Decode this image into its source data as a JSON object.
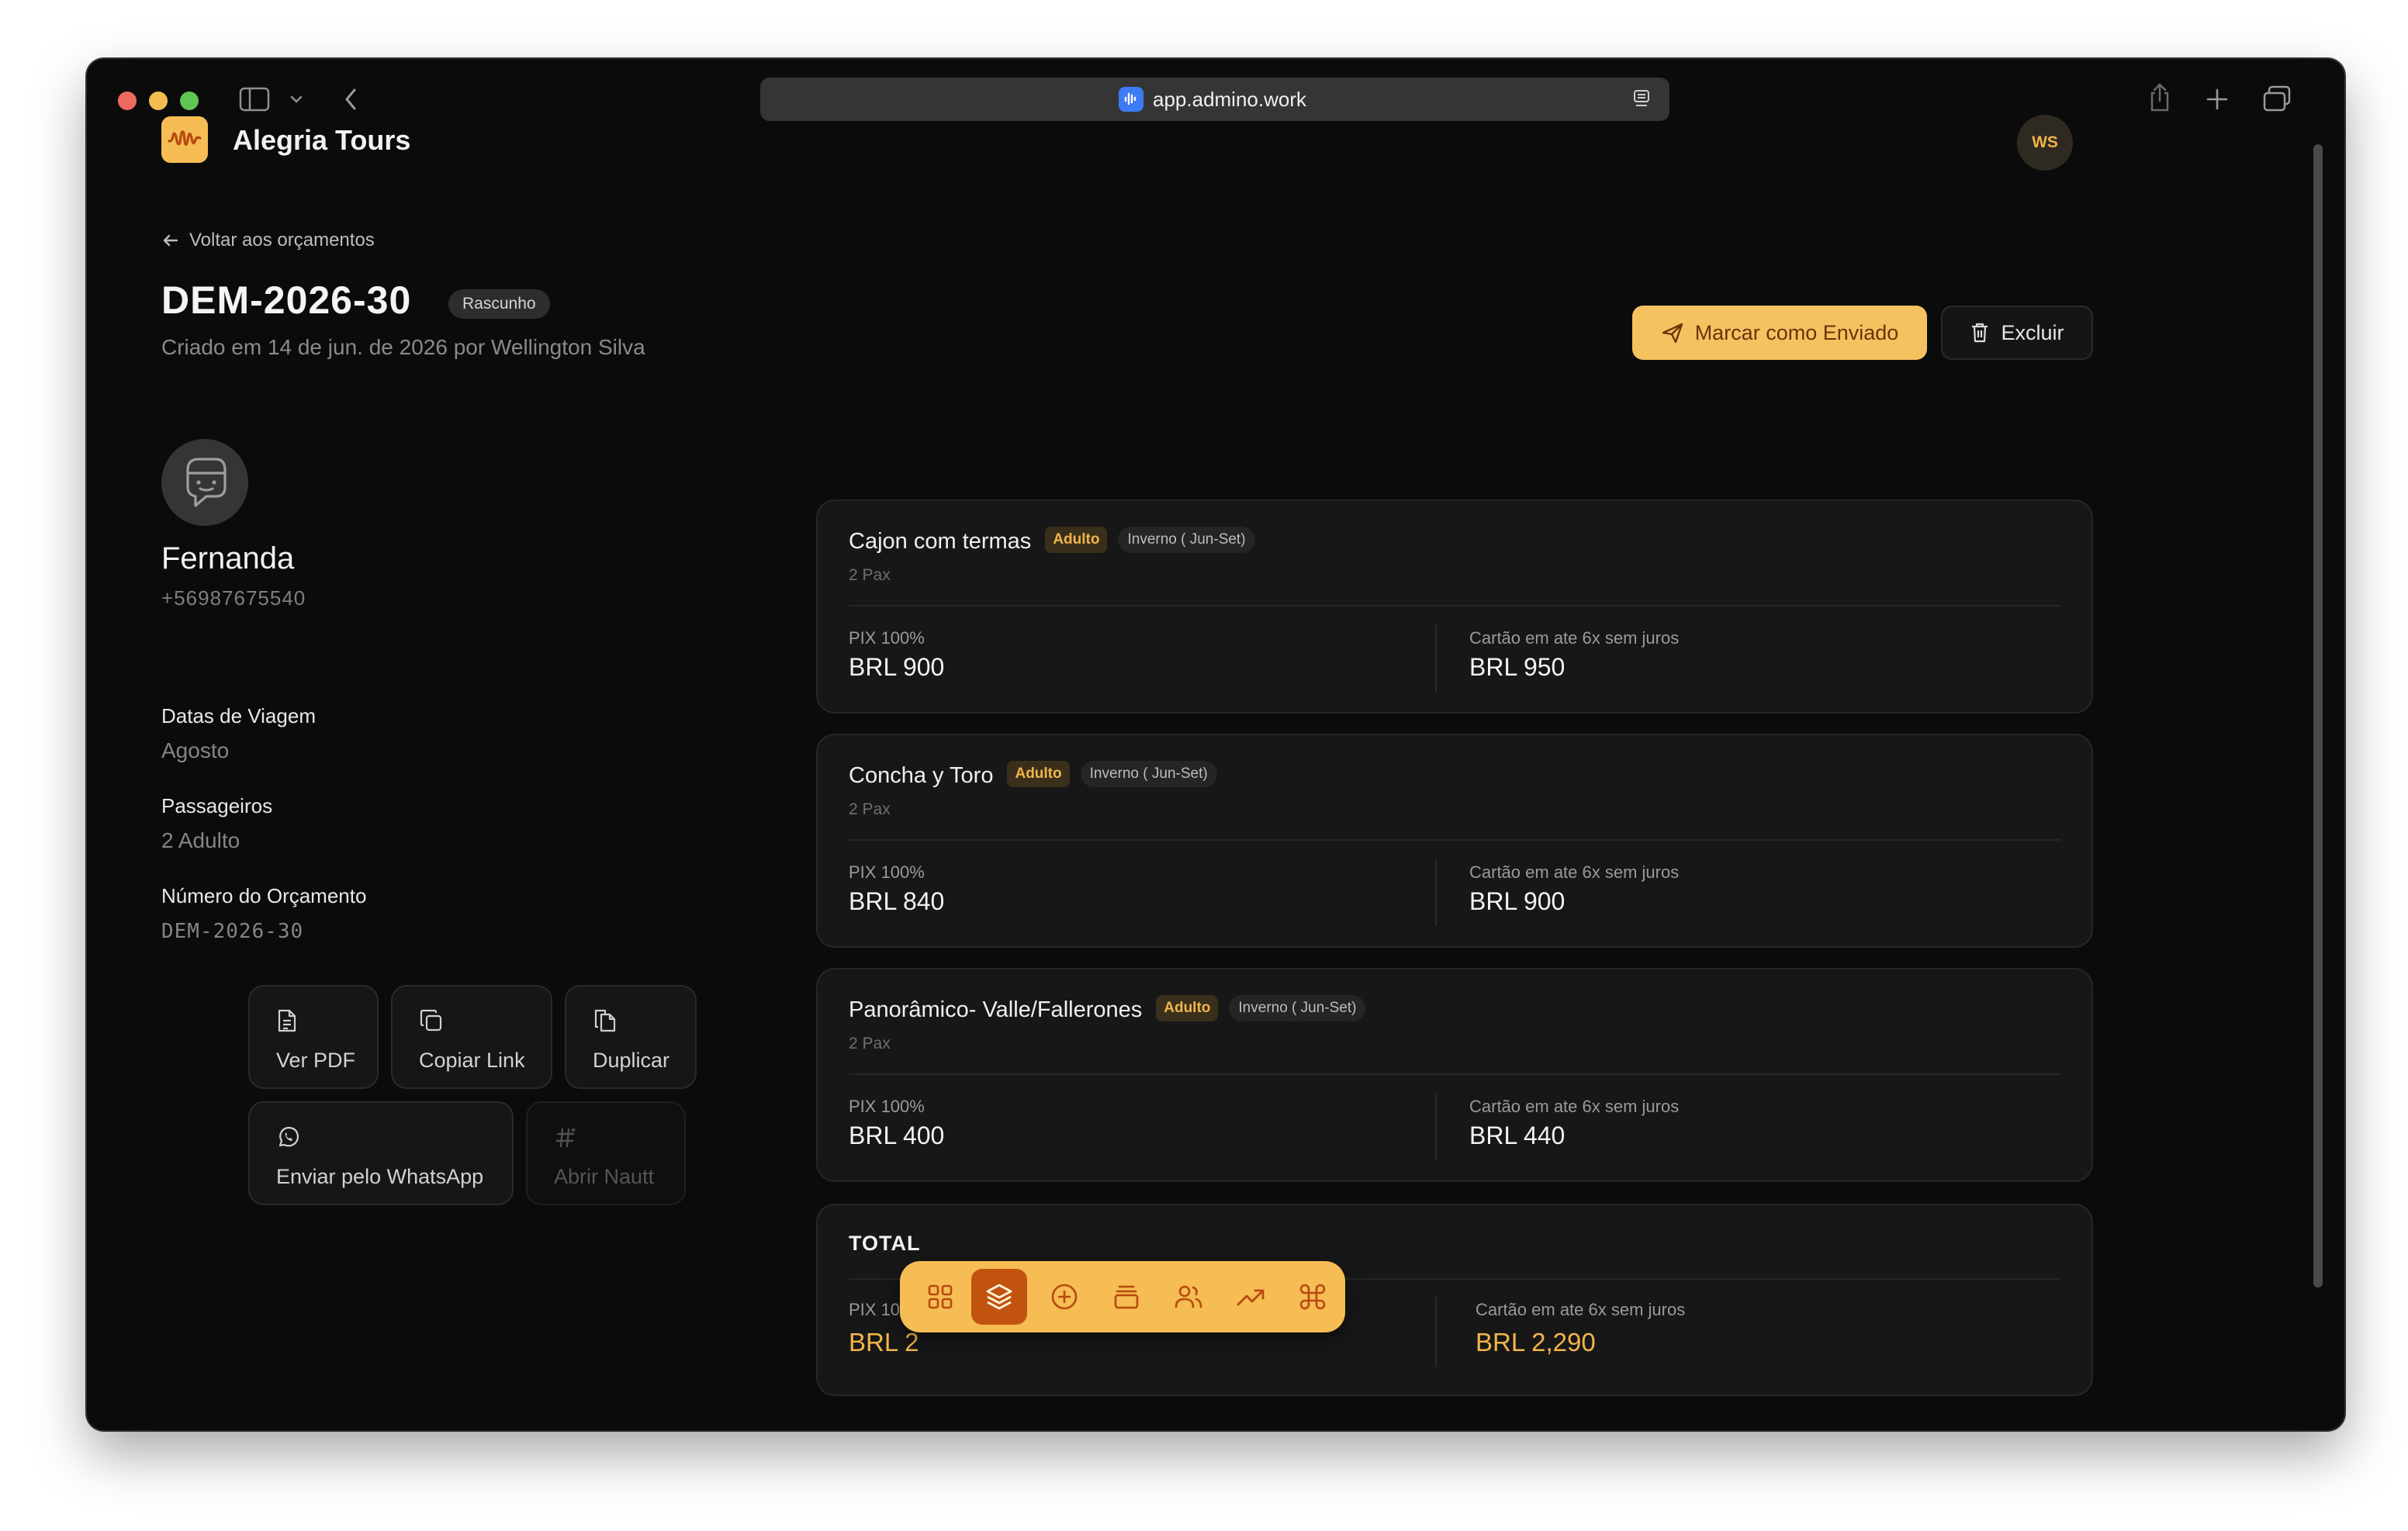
{
  "browser": {
    "url": "app.admino.work"
  },
  "app": {
    "brand": "Alegria Tours",
    "user_initials": "WS"
  },
  "page": {
    "back_label": "Voltar aos orçamentos",
    "quote_id": "DEM-2026-30",
    "status": "Rascunho",
    "created": "Criado em 14 de jun. de 2026 por Wellington Silva",
    "mark_sent_label": "Marcar como Enviado",
    "delete_label": "Excluir"
  },
  "client": {
    "name": "Fernanda",
    "phone": "+56987675540",
    "fields": [
      {
        "label": "Datas de Viagem",
        "value": "Agosto"
      },
      {
        "label": "Passageiros",
        "value": "2 Adulto"
      },
      {
        "label": "Número do Orçamento",
        "value": "DEM-2026-30"
      }
    ]
  },
  "actions": {
    "view_pdf": "Ver PDF",
    "copy_link": "Copiar Link",
    "duplicate": "Duplicar",
    "whatsapp": "Enviar pelo WhatsApp",
    "nautt": "Abrir Nautt"
  },
  "tours": [
    {
      "name": "Cajon com termas",
      "type": "Adulto",
      "season": "Inverno ( Jun-Set)",
      "pax": "2 Pax",
      "pix_label": "PIX 100%",
      "pix_value": "BRL 900",
      "card_label": "Cartão em ate 6x sem juros",
      "card_value": "BRL 950"
    },
    {
      "name": "Concha y Toro",
      "type": "Adulto",
      "season": "Inverno ( Jun-Set)",
      "pax": "2 Pax",
      "pix_label": "PIX 100%",
      "pix_value": "BRL 840",
      "card_label": "Cartão em ate 6x sem juros",
      "card_value": "BRL 900"
    },
    {
      "name": "Panorâmico- Valle/Fallerones",
      "type": "Adulto",
      "season": "Inverno ( Jun-Set)",
      "pax": "2 Pax",
      "pix_label": "PIX 100%",
      "pix_value": "BRL 400",
      "card_label": "Cartão em ate 6x sem juros",
      "card_value": "BRL 440"
    }
  ],
  "total": {
    "label": "TOTAL",
    "pix_label": "PIX 100%",
    "pix_value_visible": "BRL 2",
    "card_label": "Cartão em ate 6x sem juros",
    "card_value": "BRL 2,290"
  },
  "dock": {
    "items": [
      "grid-icon",
      "layers-icon",
      "plus-circle-icon",
      "archive-icon",
      "users-icon",
      "trending-icon",
      "command-icon"
    ],
    "active": "layers-icon"
  },
  "colors": {
    "accent": "#f5bd53",
    "accent_dark": "#c2530f",
    "background": "#0b0b0b",
    "card": "#171717"
  }
}
